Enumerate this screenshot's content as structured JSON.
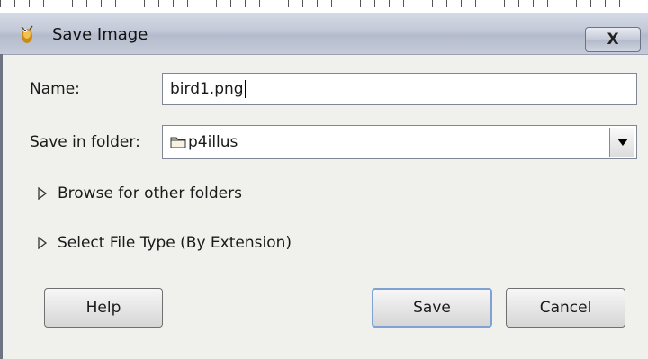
{
  "window": {
    "title": "Save Image"
  },
  "icons": {
    "app": "gimp-wilber-icon",
    "close": "close-icon",
    "folder": "folder-icon",
    "dropdown": "chevron-down-icon",
    "expander": "triangle-right-icon"
  },
  "titlebar": {
    "close_label": "X"
  },
  "form": {
    "name_label": "Name:",
    "name_value": "bird1.png",
    "folder_label": "Save in folder:",
    "folder_value": "p4illus"
  },
  "expanders": {
    "browse": "Browse for other folders",
    "file_type": "Select File Type (By Extension)"
  },
  "buttons": {
    "help": "Help",
    "save": "Save",
    "cancel": "Cancel"
  },
  "colors": {
    "titlebar": "#c2c8d6",
    "dialog": "#f0f0ed",
    "default_button_border": "#7fa1d4"
  }
}
